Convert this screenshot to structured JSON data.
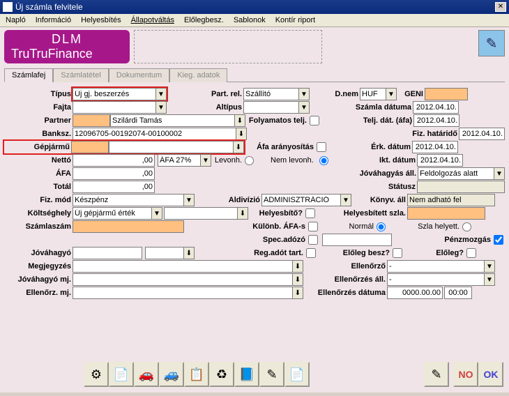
{
  "window": {
    "title": "Új számla felvitele"
  },
  "menu": {
    "items": [
      "Napló",
      "Információ",
      "Helyesbítés",
      "Állapotváltás",
      "Előlegbesz.",
      "Sablonok",
      "Kontír riport"
    ]
  },
  "brand": {
    "l1": "DLM",
    "l2": "TruFinance"
  },
  "tabs": {
    "items": [
      "Számlafej",
      "Számlatétel",
      "Dokumentum",
      "Kieg. adatok"
    ],
    "active": 0
  },
  "labels": {
    "tipus": "Típus",
    "fajta": "Fajta",
    "partner": "Partner",
    "banksz": "Banksz.",
    "gepjarmu": "Gépjármű",
    "netto": "Nettó",
    "afa": "ÁFA",
    "total": "Totál",
    "fizmod": "Fiz. mód",
    "koltseghely": "Költséghely",
    "szamlaszam": "Számlaszám",
    "jovahagyo": "Jóváhagyó",
    "megjegyzes": "Megjegyzés",
    "jovahagyomj": "Jóváhagyó mj.",
    "ellenorzmj": "Ellenőrz. mj.",
    "partrel": "Part. rel.",
    "altipus": "Altípus",
    "folyamatos": "Folyamatos telj.",
    "afaaranyositas": "Áfa arányosítás",
    "levonh": "Levonh.",
    "nemlevonh": "Nem levonh.",
    "aldivizio": "Aldivízió",
    "helyesbito": "Helyesbítő?",
    "kulonbafas": "Különb. ÁFA-s",
    "specadozo": "Spec.adózó",
    "regadot": "Reg.adót tart.",
    "dnem": "D.nem",
    "geni": "GENI",
    "szamladatuma": "Számla dátuma",
    "teljdat": "Telj. dát. (áfa)",
    "fizhatarid": "Fiz. határidő",
    "erkdatum": "Érk. dátum",
    "iktdatum": "Ikt. dátum",
    "jovahagyasall": "Jóváhagyás áll.",
    "statusz": "Státusz",
    "konyvall": "Könyv. áll",
    "helyesbitettszla": "Helyesbített szla.",
    "normal": "Normál",
    "szlahelyett": "Szla helyett.",
    "penzmozgas": "Pénzmozgás",
    "elolegbesz": "Előleg besz?",
    "eloleg": "Előleg?",
    "ellenorzo": "Ellenőrző",
    "ellenorzesall": "Ellenőrzés áll.",
    "ellenorzesdat": "Ellenőrzés dátuma"
  },
  "values": {
    "tipus": "Új gj. beszerzés",
    "partner_name": "Szilárdi Tamás",
    "banksz": "12096705-00192074-00100002",
    "netto": ",00",
    "afa": ",00",
    "total": ",00",
    "fizmod": "Készpénz",
    "koltseghely": "Új gépjármű érték",
    "partrel": "Szállító",
    "afakulcs": "ÁFA 27%",
    "aldivizio": "ADMINISZTRÁCIÓ",
    "dnem": "HUF",
    "date": "2012.04.10.",
    "jovahagyasall": "Feldolgozás alatt",
    "konyvall": "Nem adható fel",
    "ellenorzo": "-",
    "ellenorzesall": "-",
    "ellenorzesdat": "0000.00.00",
    "ellenorzestime": "00:00"
  },
  "toolbar": {
    "icons": [
      "⚙",
      "📄",
      "🚗",
      "🚙",
      "📋",
      "♻",
      "📘",
      "✎",
      "📄"
    ],
    "right": [
      "✎",
      "NO",
      "OK"
    ]
  }
}
